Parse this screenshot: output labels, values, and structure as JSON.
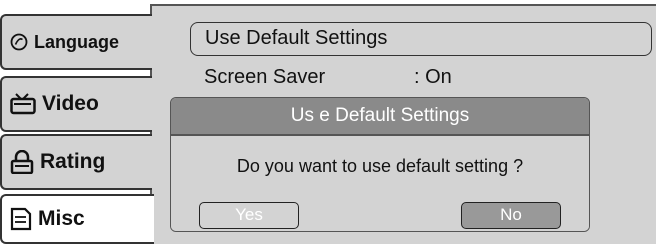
{
  "sidebar": {
    "tabs": [
      {
        "label": "Language",
        "icon": "disc-icon"
      },
      {
        "label": "Video",
        "icon": "tv-icon"
      },
      {
        "label": "Rating",
        "icon": "lock-icon"
      },
      {
        "label": "Misc",
        "icon": "document-icon"
      }
    ],
    "active_tab": "Misc"
  },
  "menu": {
    "items": [
      {
        "label": "Use Default Settings"
      },
      {
        "label": "Screen Saver",
        "value": ": On"
      }
    ]
  },
  "dialog": {
    "title": "Us e Default  Settings",
    "message": "Do you want to use default setting ?",
    "yes_label": "Yes",
    "no_label": "No"
  },
  "colors": {
    "panel_bg": "#d3d3d3",
    "dialog_title_bg": "#8a8a8a",
    "selected_button_bg": "#999999"
  }
}
